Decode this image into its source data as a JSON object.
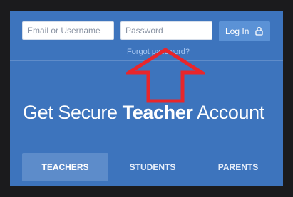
{
  "login": {
    "email_placeholder": "Email or Username",
    "password_placeholder": "Password",
    "login_label": "Log In",
    "forgot_label": "Forgot password?"
  },
  "hero": {
    "prefix": "Get Secure ",
    "emphasis": "Teacher",
    "suffix": " Account"
  },
  "tabs": [
    {
      "label": "TEACHERS",
      "active": true
    },
    {
      "label": "STUDENTS",
      "active": false
    },
    {
      "label": "PARENTS",
      "active": false
    }
  ],
  "annotation": {
    "shape": "arrow-up-icon",
    "color": "#e8262b"
  },
  "colors": {
    "background": "#3d74bd",
    "button": "#5b92d6",
    "active_tab": "#5d8cca"
  }
}
